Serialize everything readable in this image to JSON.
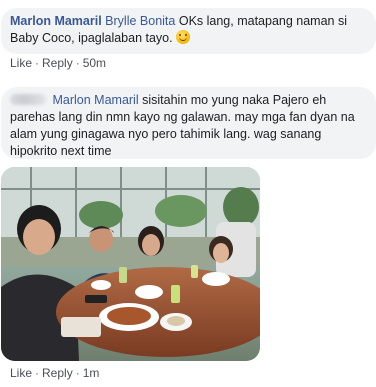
{
  "comments": [
    {
      "author": "Marlon Mamaril",
      "tagged": "Brylle Bonita",
      "text": "OKs lang, matapang naman si Baby Coco, ipaglalaban tayo.",
      "emoji": "smiling-emoji",
      "actions": {
        "like": "Like",
        "reply": "Reply",
        "time": "50m"
      }
    },
    {
      "author": "",
      "tagged": "Marlon Mamaril",
      "text": "sisitahin mo yung naka Pajero eh parehas lang din nmn kayo ng galawan. may mga fan dyan na alam yung ginagawa nyo pero tahimik lang. wag sanang hipokrito next time",
      "actions": {
        "like": "Like",
        "reply": "Reply",
        "time": "1m"
      }
    }
  ],
  "photo": {
    "alt": "Group of five people seated at a round dining table in a bright restaurant"
  },
  "separator": "·"
}
